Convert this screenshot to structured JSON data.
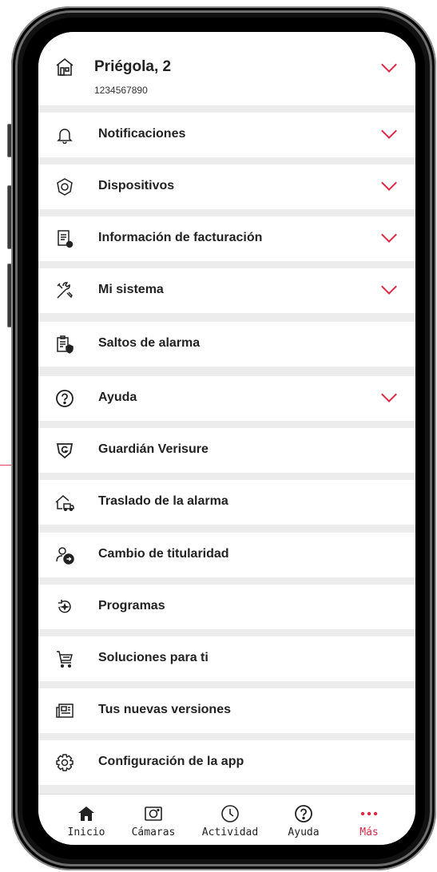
{
  "account": {
    "title": "Priégola, 2",
    "number": "1234567890"
  },
  "menu": [
    {
      "label": "Notificaciones",
      "icon": "bell-icon",
      "expandable": true
    },
    {
      "label": "Dispositivos",
      "icon": "device-shield-icon",
      "expandable": true
    },
    {
      "label": "Información de facturación",
      "icon": "invoice-icon",
      "expandable": true
    },
    {
      "label": "Mi sistema",
      "icon": "tools-icon",
      "expandable": true
    },
    {
      "label": "Saltos de alarma",
      "icon": "clipboard-shield-icon",
      "expandable": false
    },
    {
      "label": "Ayuda",
      "icon": "help-circle-icon",
      "expandable": true
    },
    {
      "label": "Guardián Verisure",
      "icon": "guardian-shield-icon",
      "expandable": false
    },
    {
      "label": "Traslado de la alarma",
      "icon": "house-truck-icon",
      "expandable": false
    },
    {
      "label": "Cambio de titularidad",
      "icon": "user-swap-icon",
      "expandable": false
    },
    {
      "label": "Programas",
      "icon": "refresh-star-icon",
      "expandable": false
    },
    {
      "label": "Soluciones para ti",
      "icon": "cart-icon",
      "expandable": false
    },
    {
      "label": "Tus nuevas versiones",
      "icon": "newspaper-icon",
      "expandable": false
    },
    {
      "label": "Configuración de la app",
      "icon": "gear-icon",
      "expandable": false
    }
  ],
  "tabs": [
    {
      "label": "Inicio",
      "icon": "home-icon"
    },
    {
      "label": "Cámaras",
      "icon": "camera-icon"
    },
    {
      "label": "Actividad",
      "icon": "clock-icon"
    },
    {
      "label": "Ayuda",
      "icon": "help-circle-icon"
    },
    {
      "label": "Más",
      "icon": "more-dots-icon",
      "active": true
    }
  ],
  "colors": {
    "accent": "#d92a45",
    "background": "#ececec",
    "text": "#222222"
  }
}
